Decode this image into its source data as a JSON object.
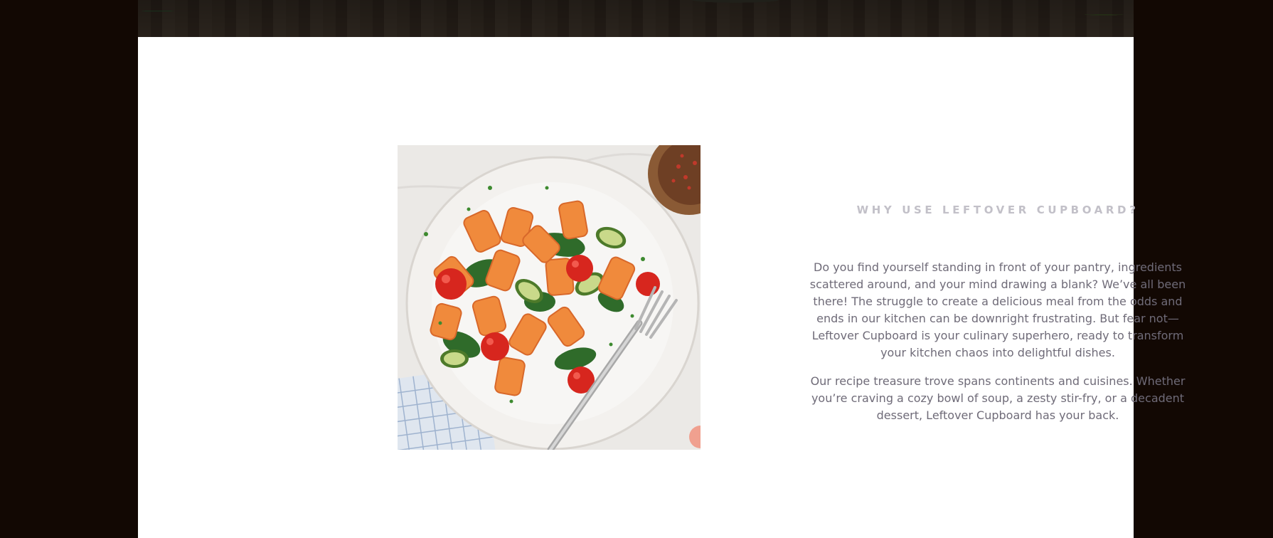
{
  "section": {
    "heading": "WHY USE LEFTOVER CUPBOARD?",
    "paragraphs": [
      "Do you find yourself standing in front of your pantry, ingredients scattered around, and your mind drawing a blank? We’ve all been there! The struggle to create a delicious meal from the odds and ends in our kitchen can be downright frustrating. But fear not—Leftover Cupboard is your culinary superhero, ready to transform your kitchen chaos into delightful dishes.",
      "Our recipe treasure trove spans continents and cuisines. Whether you’re craving a cozy bowl of soup, a zesty stir-fry, or a decadent dessert, Leftover Cupboard has your back."
    ]
  },
  "image": {
    "subject": "pasta-plate-photo"
  },
  "colors": {
    "page_background": "#120803",
    "card_background": "#ffffff",
    "heading": "#c2c0c8",
    "body_text": "#6f6b78"
  }
}
